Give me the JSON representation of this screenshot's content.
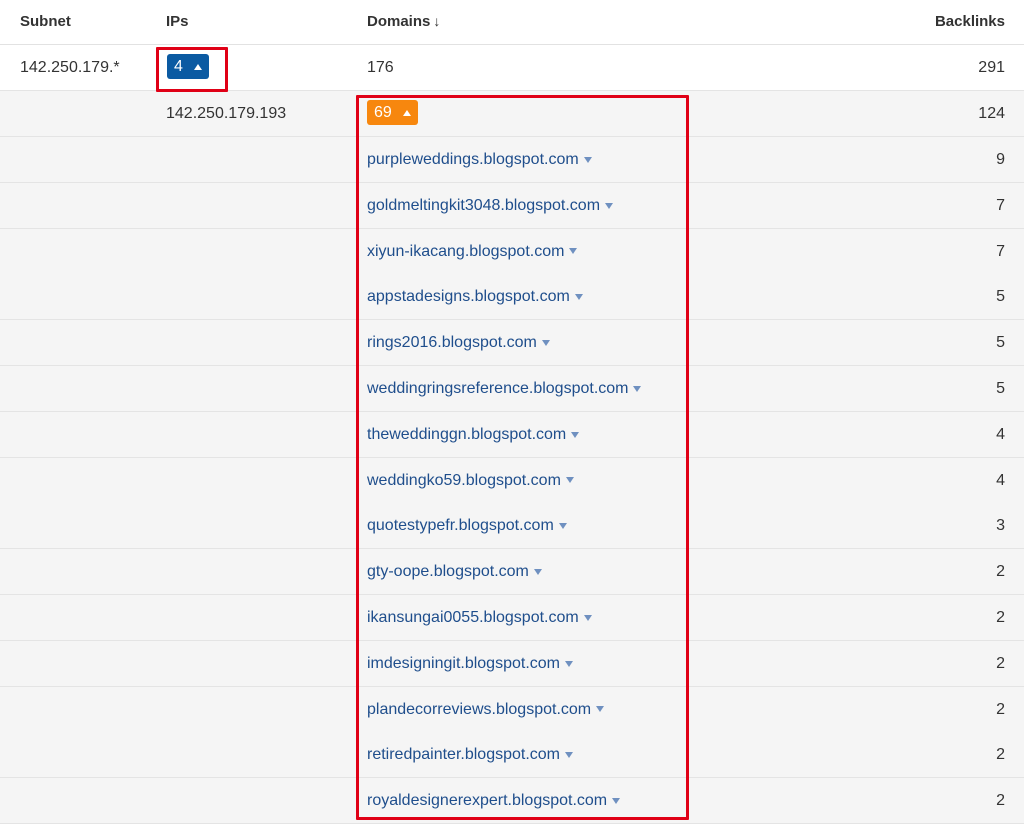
{
  "columns": {
    "subnet": "Subnet",
    "ips": "IPs",
    "domains": "Domains",
    "domains_sort_icon": "down-arrow",
    "backlinks": "Backlinks"
  },
  "subnet_row": {
    "subnet": "142.250.179.*",
    "ips_count": "4",
    "domains": "176",
    "backlinks": "291",
    "ips_badge_color": "#0b5aa2"
  },
  "ip_row": {
    "ip": "142.250.179.193",
    "domains_count": "69",
    "backlinks": "124",
    "domains_badge_color": "#f7870e"
  },
  "domain_rows": [
    {
      "domain": "purpleweddings.blogspot.com",
      "backlinks": "9"
    },
    {
      "domain": "goldmeltingkit3048.blogspot.com",
      "backlinks": "7"
    },
    {
      "domain": "xiyun-ikacang.blogspot.com",
      "backlinks": "7"
    },
    {
      "domain": "appstadesigns.blogspot.com",
      "backlinks": "5"
    },
    {
      "domain": "rings2016.blogspot.com",
      "backlinks": "5"
    },
    {
      "domain": "weddingringsreference.blogspot.com",
      "backlinks": "5"
    },
    {
      "domain": "theweddinggn.blogspot.com",
      "backlinks": "4"
    },
    {
      "domain": "weddingko59.blogspot.com",
      "backlinks": "4"
    },
    {
      "domain": "quotestypefr.blogspot.com",
      "backlinks": "3"
    },
    {
      "domain": "gty-oope.blogspot.com",
      "backlinks": "2"
    },
    {
      "domain": "ikansungai0055.blogspot.com",
      "backlinks": "2"
    },
    {
      "domain": "imdesigningit.blogspot.com",
      "backlinks": "2"
    },
    {
      "domain": "plandecorreviews.blogspot.com",
      "backlinks": "2"
    },
    {
      "domain": "retiredpainter.blogspot.com",
      "backlinks": "2"
    },
    {
      "domain": "royaldesignerexpert.blogspot.com",
      "backlinks": "2"
    }
  ],
  "highlight_color": "#e00016"
}
